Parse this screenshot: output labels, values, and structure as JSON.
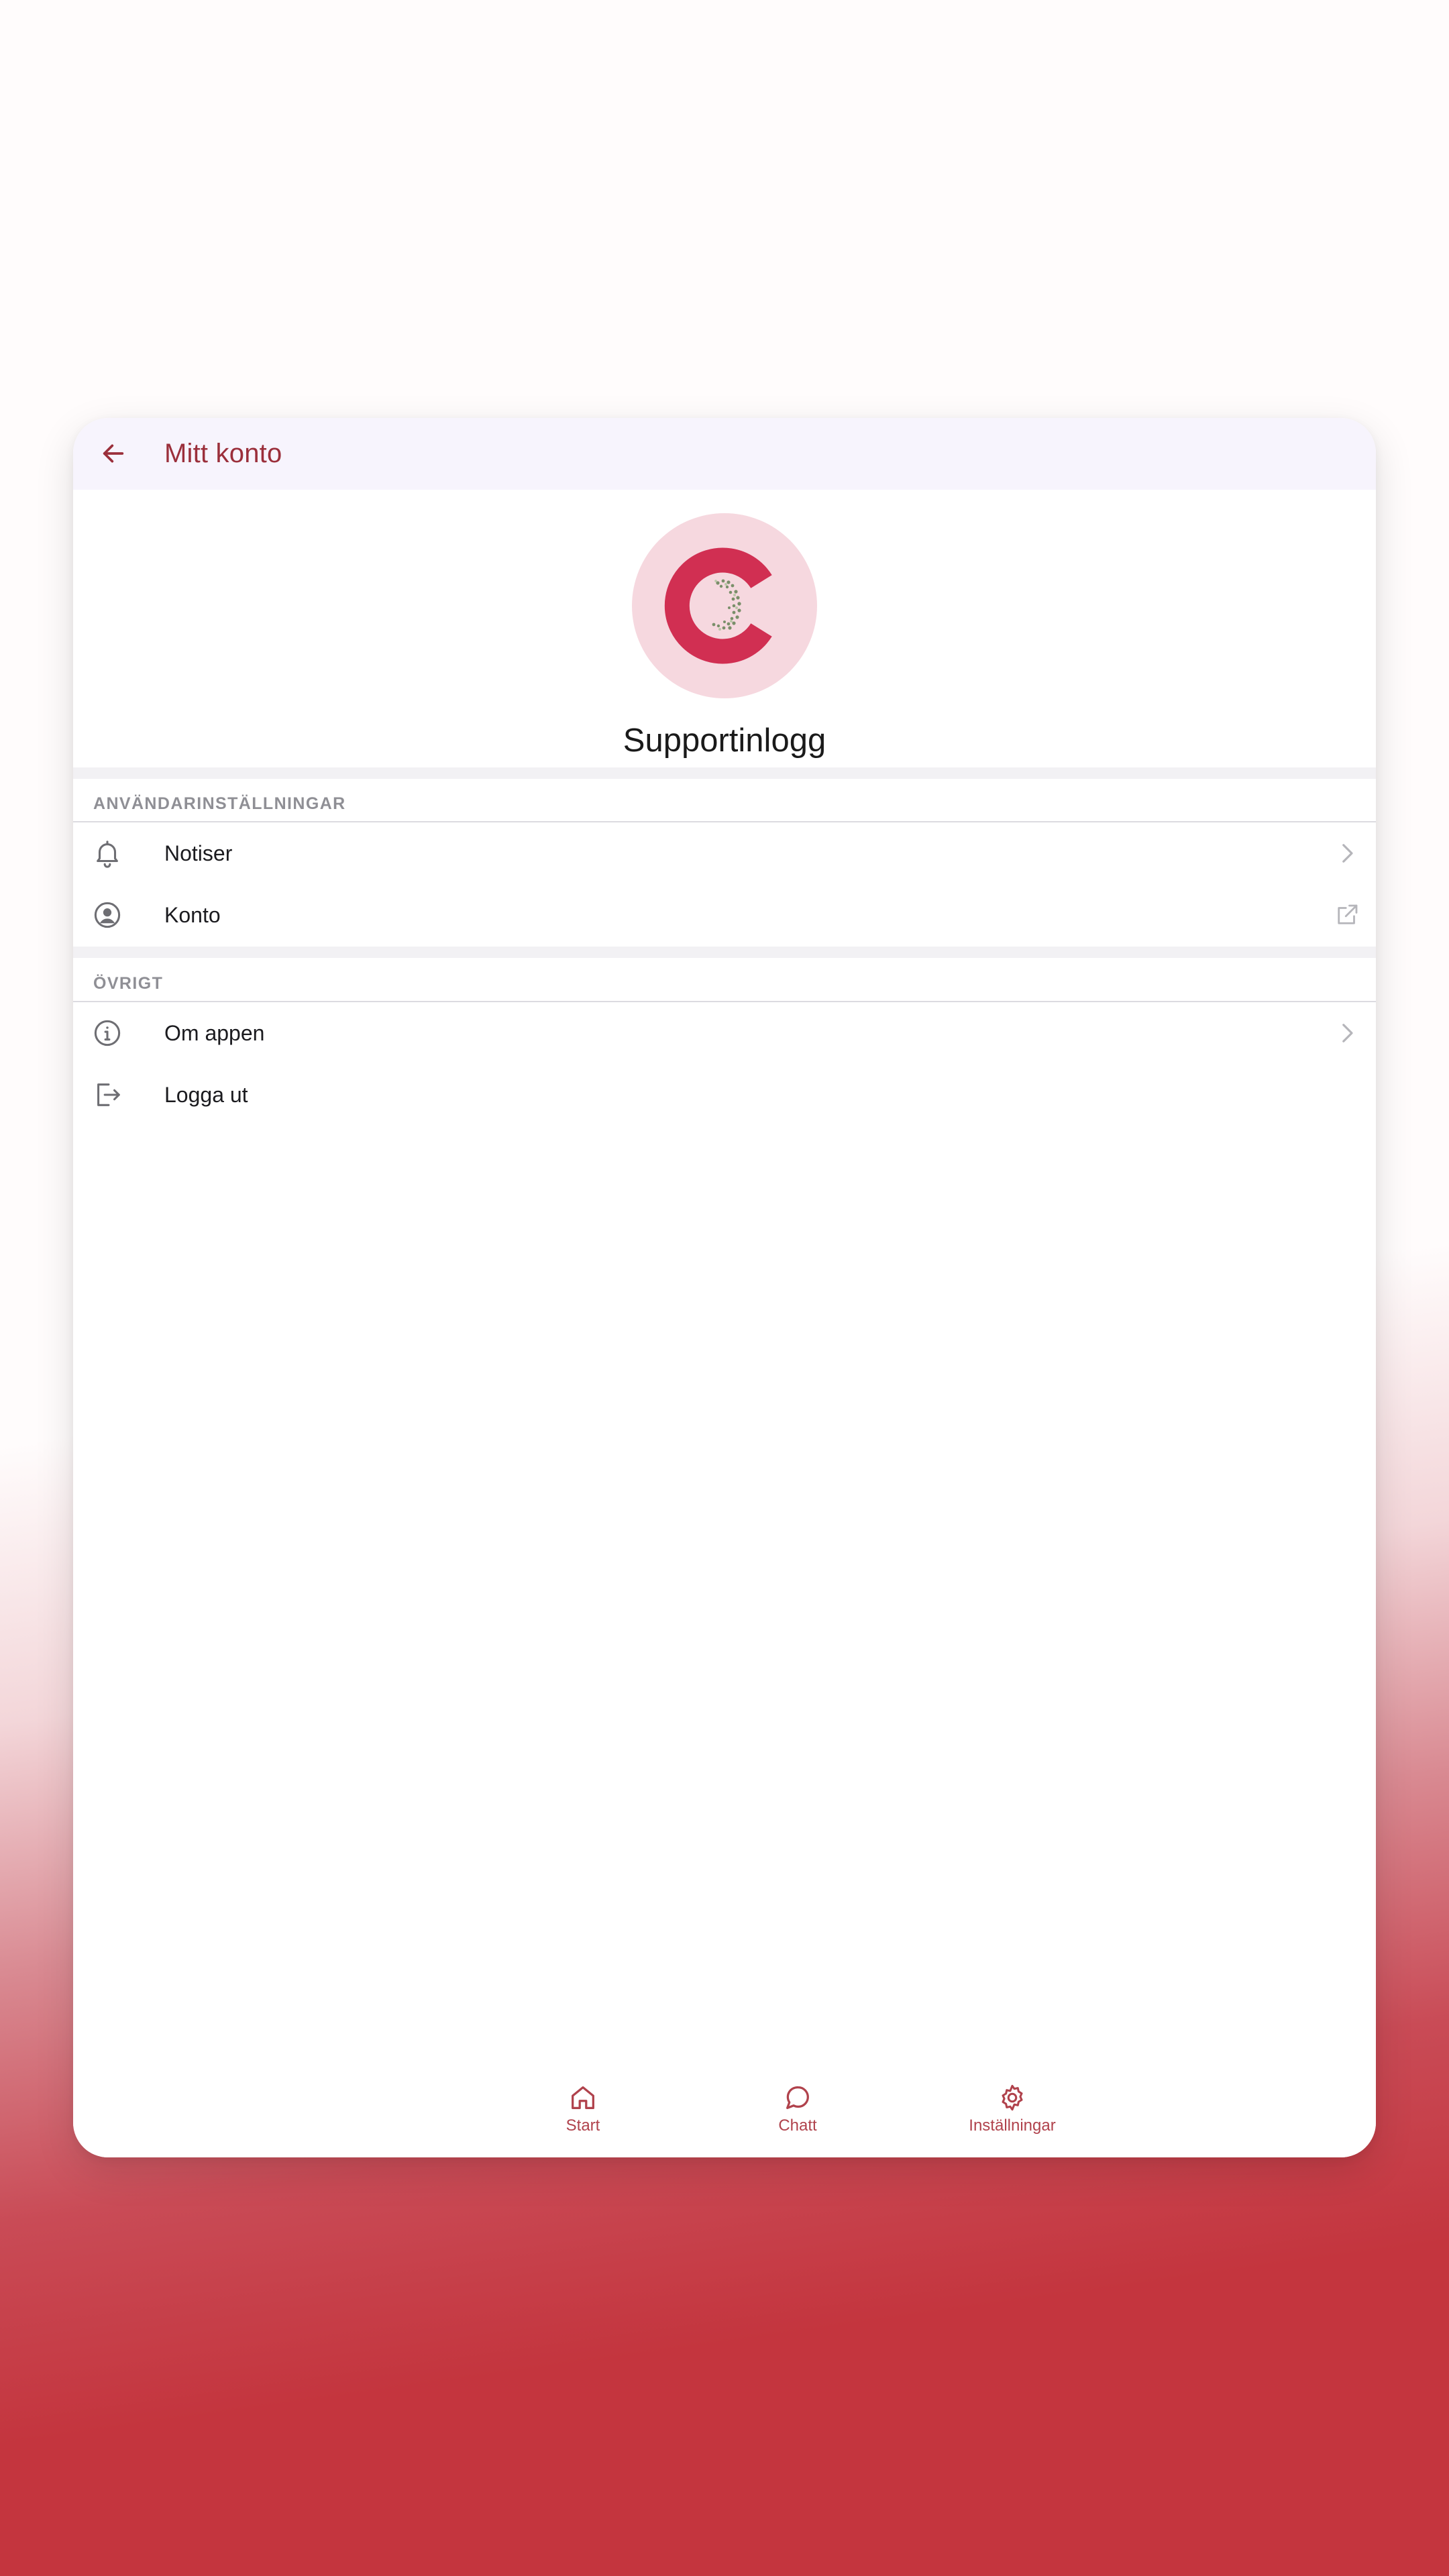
{
  "header": {
    "title": "Mitt konto"
  },
  "profile": {
    "name": "Supportinlogg"
  },
  "sections": [
    {
      "title": "ANVÄNDARINSTÄLLNINGAR",
      "items": [
        {
          "label": "Notiser",
          "icon": "bell-icon",
          "trailing": "chevron-right-icon"
        },
        {
          "label": "Konto",
          "icon": "user-circle-icon",
          "trailing": "external-link-icon"
        }
      ]
    },
    {
      "title": "ÖVRIGT",
      "items": [
        {
          "label": "Om appen",
          "icon": "info-icon",
          "trailing": "chevron-right-icon"
        },
        {
          "label": "Logga ut",
          "icon": "logout-icon",
          "trailing": ""
        }
      ]
    }
  ],
  "bottom_nav": {
    "items": [
      {
        "label": "Start",
        "icon": "home-icon"
      },
      {
        "label": "Chatt",
        "icon": "chat-icon"
      },
      {
        "label": "Inställningar",
        "icon": "gear-icon"
      }
    ]
  },
  "colors": {
    "accent": "#9b2f3b",
    "nav_accent": "#b0424c",
    "appbar_bg": "#f7f4fd",
    "avatar_bg": "#f6d8df",
    "logo_red": "#d12f52"
  }
}
